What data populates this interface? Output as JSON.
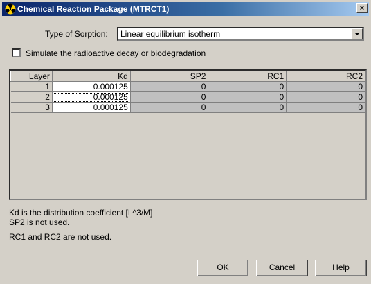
{
  "window": {
    "title": "Chemical Reaction Package (MTRCT1)",
    "close_glyph": "×",
    "icon": "radiation-icon"
  },
  "sorption": {
    "label": "Type of Sorption:",
    "selected": "Linear equilibrium isotherm"
  },
  "decay": {
    "label": "Simulate the radioactive decay or biodegradation",
    "checked": false
  },
  "grid": {
    "columns": [
      "Layer",
      "Kd",
      "SP2",
      "RC1",
      "RC2"
    ],
    "rows": [
      [
        "1",
        "0.000125",
        "0",
        "0",
        "0"
      ],
      [
        "2",
        "0.000125",
        "0",
        "0",
        "0"
      ],
      [
        "3",
        "0.000125",
        "0",
        "0",
        "0"
      ]
    ]
  },
  "notes": {
    "line1": "Kd is the distribution coefficient [L^3/M]",
    "line2": "SP2 is not used.",
    "line3": "RC1 and RC2 are not used."
  },
  "buttons": {
    "ok": "OK",
    "cancel": "Cancel",
    "help": "Help"
  },
  "colors": {
    "titlebar_start": "#0a246a",
    "titlebar_end": "#a6caf0",
    "face": "#d4d0c8",
    "disabled_cell": "#c0c0c0"
  }
}
